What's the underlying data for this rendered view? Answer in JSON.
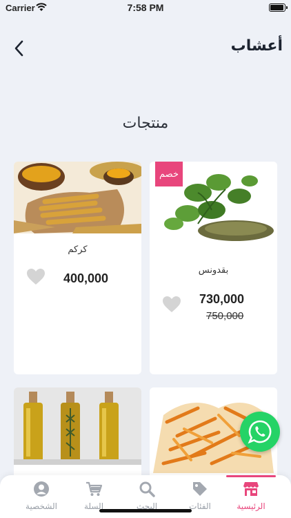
{
  "status_bar": {
    "carrier": "Carrier",
    "time": "7:58 PM"
  },
  "header": {
    "title": "أعشاب",
    "back_icon": "chevron-left-icon"
  },
  "section": {
    "title": "منتجات"
  },
  "products": [
    {
      "name": "كركم",
      "price": "400,000",
      "image": "turmeric"
    },
    {
      "name": "بقدونس",
      "price": "730,000",
      "old_price": "750,000",
      "badge": "خصم",
      "image": "herbs"
    },
    {
      "name": "",
      "image": "oil-bottles"
    },
    {
      "name": "",
      "image": "orange-peel"
    }
  ],
  "tabs": [
    {
      "label": "الشخصية",
      "icon": "user-icon"
    },
    {
      "label": "السلة",
      "icon": "cart-icon"
    },
    {
      "label": "البحث",
      "icon": "search-icon"
    },
    {
      "label": "الفئات",
      "icon": "tag-icon"
    },
    {
      "label": "الرئيسية",
      "icon": "store-icon",
      "active": true
    }
  ],
  "colors": {
    "accent": "#e8467c",
    "whatsapp": "#25d366",
    "background": "#eef1f7"
  }
}
